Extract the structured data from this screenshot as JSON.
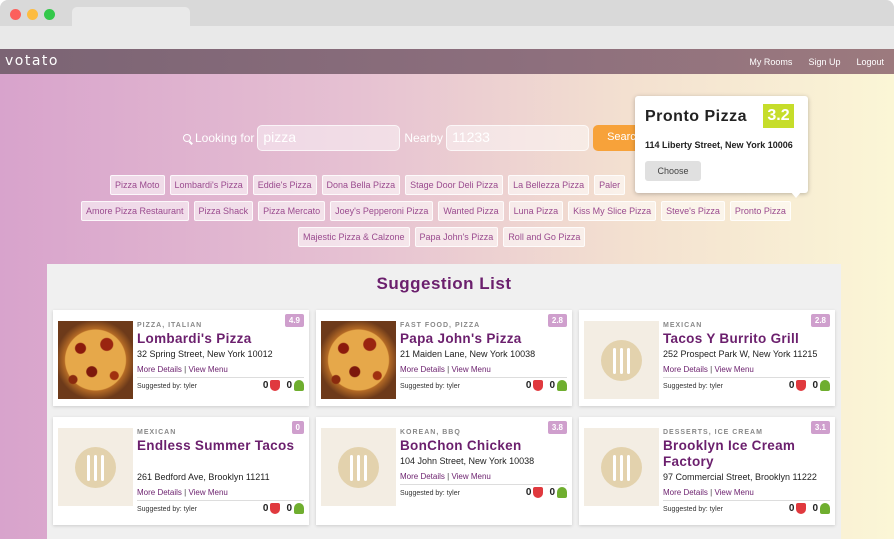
{
  "app": {
    "logo": "votato",
    "nav": [
      "My Rooms",
      "Sign Up",
      "Logout"
    ]
  },
  "search": {
    "looking_for_label": "Looking for",
    "looking_for_value": "pizza",
    "nearby_label": "Nearby",
    "nearby_value": "11233",
    "button_label": "Search"
  },
  "chips": {
    "row1": [
      "Pizza Moto",
      "Lombardi's Pizza",
      "Eddie's Pizza",
      "Dona Bella Pizza",
      "Stage Door Deli Pizza",
      "La Bellezza Pizza",
      "Paler"
    ],
    "row2": [
      "Amore Pizza Restaurant",
      "Pizza Shack",
      "Pizza Mercato",
      "Joey's Pepperoni Pizza",
      "Wanted Pizza",
      "Luna Pizza",
      "Kiss My Slice Pizza",
      "Steve's Pizza",
      "Pronto Pizza"
    ],
    "row3": [
      "Majestic Pizza & Calzone",
      "Papa John's Pizza",
      "Roll and Go Pizza"
    ]
  },
  "popup": {
    "title": "Pronto Pizza",
    "rating": "3.2",
    "address": "114 Liberty Street, New York 10006",
    "choose_label": "Choose"
  },
  "suggestions": {
    "title": "Suggestion List",
    "cards": [
      {
        "rating": "4.9",
        "category": "PIZZA, ITALIAN",
        "name": "Lombardi's Pizza",
        "address": "32 Spring Street, New York 10012",
        "more": "More Details",
        "menu": "View Menu",
        "suggested": "Suggested by: tyler",
        "down": "0",
        "up": "0",
        "image": "pizza"
      },
      {
        "rating": "2.8",
        "category": "FAST FOOD, PIZZA",
        "name": "Papa John's Pizza",
        "address": "21 Maiden Lane, New York 10038",
        "more": "More Details",
        "menu": "View Menu",
        "suggested": "Suggested by: tyler",
        "down": "0",
        "up": "0",
        "image": "pizza"
      },
      {
        "rating": "2.8",
        "category": "MEXICAN",
        "name": "Tacos Y Burrito Grill",
        "address": "252 Prospect Park W, New York 11215",
        "more": "More Details",
        "menu": "View Menu",
        "suggested": "Suggested by: tyler",
        "down": "0",
        "up": "0",
        "image": "placeholder"
      },
      {
        "rating": "0",
        "category": "MEXICAN",
        "name": "Endless Summer Tacos",
        "address": "261 Bedford Ave, Brooklyn 11211",
        "more": "More Details",
        "menu": "View Menu",
        "suggested": "Suggested by: tyler",
        "down": "0",
        "up": "0",
        "image": "placeholder"
      },
      {
        "rating": "3.8",
        "category": "KOREAN, BBQ",
        "name": "BonChon Chicken",
        "address": "104 John Street, New York 10038",
        "more": "More Details",
        "menu": "View Menu",
        "suggested": "Suggested by: tyler",
        "down": "0",
        "up": "0",
        "image": "placeholder"
      },
      {
        "rating": "3.1",
        "category": "DESSERTS, ICE CREAM",
        "name": "Brooklyn Ice Cream Factory",
        "address": "97 Commercial Street, Brooklyn 11222",
        "more": "More Details",
        "menu": "View Menu",
        "suggested": "Suggested by: tyler",
        "down": "0",
        "up": "0",
        "image": "placeholder"
      }
    ]
  }
}
